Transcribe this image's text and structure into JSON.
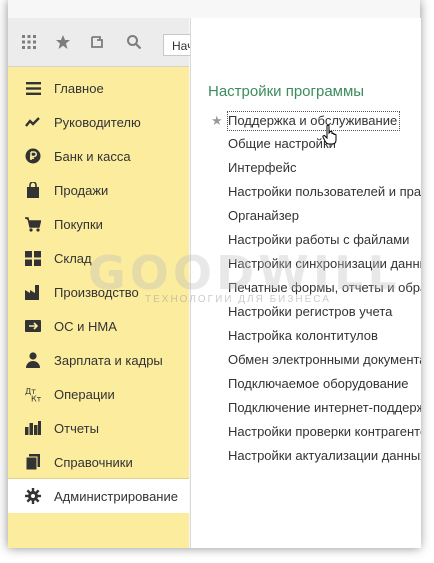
{
  "toolbar": {
    "icons": [
      "apps-grid-icon",
      "star-icon",
      "history-icon",
      "search-icon"
    ],
    "search_text": "Нач"
  },
  "sidebar": {
    "items": [
      {
        "label": "Главное",
        "icon": "menu-lines-icon"
      },
      {
        "label": "Руководителю",
        "icon": "trend-icon"
      },
      {
        "label": "Банк и касса",
        "icon": "ruble-icon"
      },
      {
        "label": "Продажи",
        "icon": "shopping-bag-icon"
      },
      {
        "label": "Покупки",
        "icon": "cart-icon"
      },
      {
        "label": "Склад",
        "icon": "warehouse-icon"
      },
      {
        "label": "Производство",
        "icon": "factory-icon"
      },
      {
        "label": "ОС и НМА",
        "icon": "assets-icon"
      },
      {
        "label": "Зарплата и кадры",
        "icon": "person-icon"
      },
      {
        "label": "Операции",
        "icon": "debit-credit-icon"
      },
      {
        "label": "Отчеты",
        "icon": "bar-chart-icon"
      },
      {
        "label": "Справочники",
        "icon": "books-icon"
      },
      {
        "label": "Администрирование",
        "icon": "gear-icon",
        "active": true
      }
    ]
  },
  "panel": {
    "title": "Настройки программы",
    "links": [
      "Поддержка и обслуживание",
      "Общие настройки",
      "Интерфейс",
      "Настройки пользователей и прав",
      "Органайзер",
      "Настройки работы с файлами",
      "Настройки синхронизации данны",
      "Печатные формы, отчеты и обраб",
      "Настройки регистров учета",
      "Настройка колонтитулов",
      "Обмен электронными документа",
      "Подключаемое оборудование",
      "Подключение интернет-поддержк",
      "Настройки проверки контрагентов",
      "Настройки актуализации данных"
    ]
  },
  "watermark": {
    "big": "GOODWILL",
    "small": "ТЕХНОЛОГИИ ДЛЯ БИЗНЕСА"
  }
}
